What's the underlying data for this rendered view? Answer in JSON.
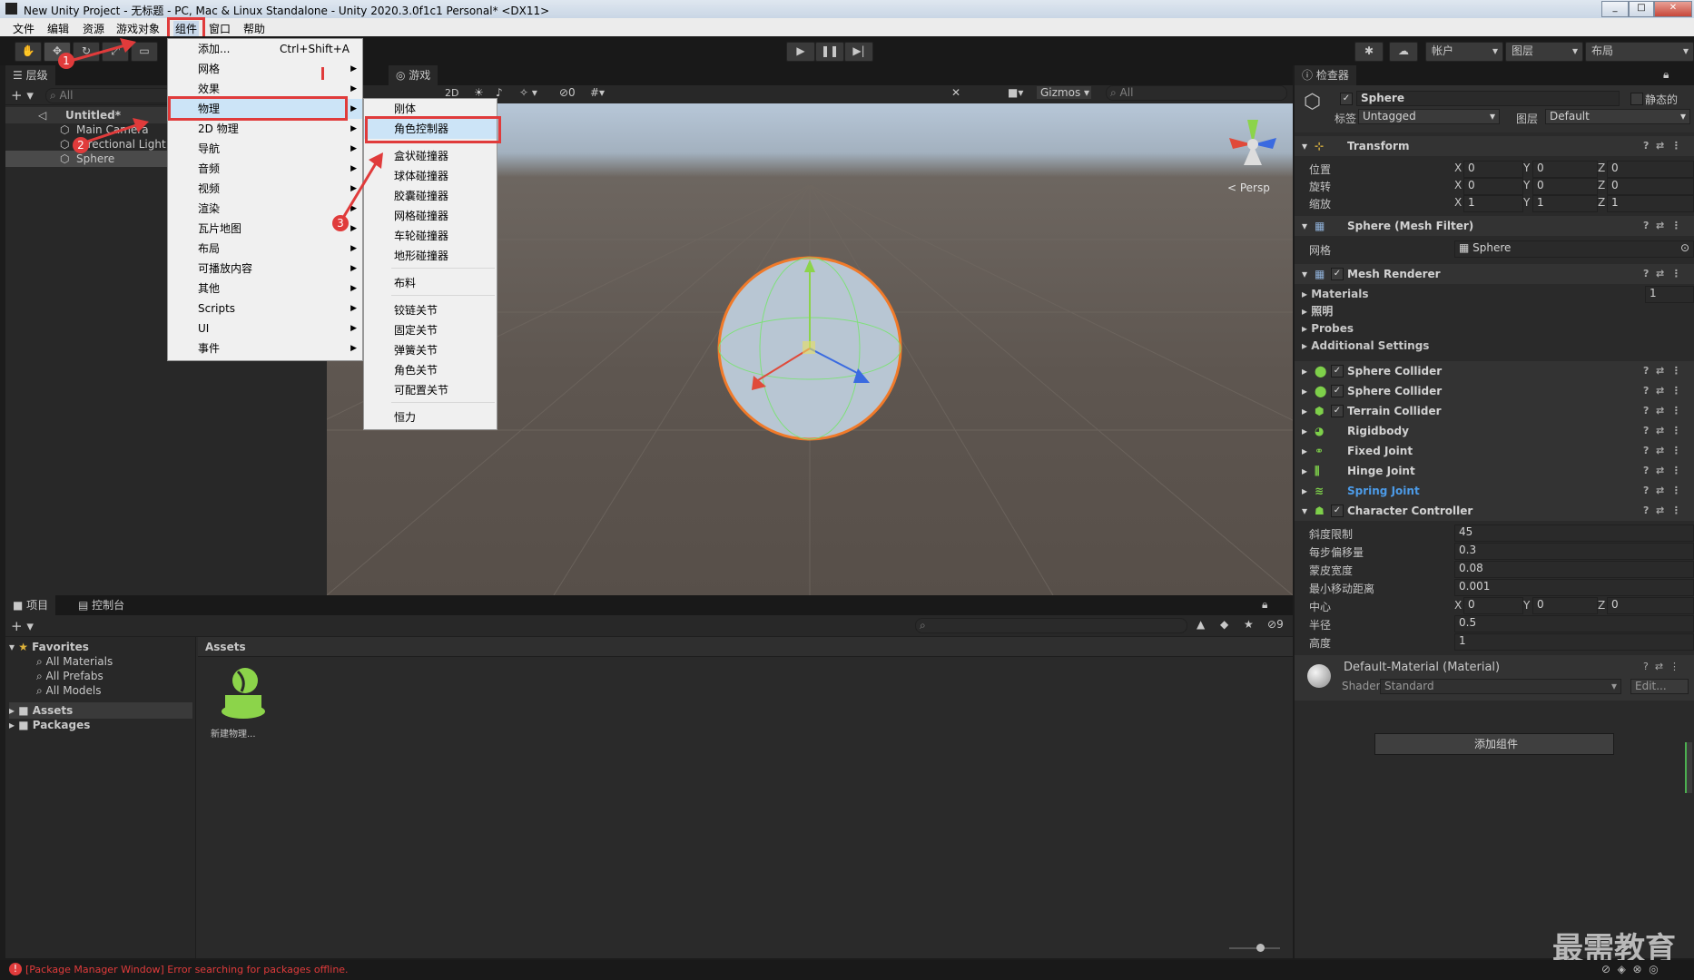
{
  "window": {
    "title": "New Unity Project - 无标题 - PC, Mac & Linux Standalone - Unity 2020.3.0f1c1 Personal* <DX11>"
  },
  "menubar": [
    "文件",
    "编辑",
    "资源",
    "游戏对象",
    "组件",
    "窗口",
    "帮助"
  ],
  "toolbar": {
    "account": "帐户",
    "layers": "图层",
    "layout": "布局"
  },
  "hierarchy": {
    "tab": "层级",
    "search": "All",
    "scene": "Untitled*",
    "items": [
      "Main Camera",
      "Directional Light",
      "Sphere"
    ]
  },
  "component_menu": {
    "items": [
      {
        "label": "添加...",
        "shortcut": "Ctrl+Shift+A"
      },
      {
        "label": "网格"
      },
      {
        "label": "效果"
      },
      {
        "label": "物理"
      },
      {
        "label": "2D 物理"
      },
      {
        "label": "导航"
      },
      {
        "label": "音频"
      },
      {
        "label": "视频"
      },
      {
        "label": "渲染"
      },
      {
        "label": "瓦片地图"
      },
      {
        "label": "布局"
      },
      {
        "label": "可播放内容"
      },
      {
        "label": "其他"
      },
      {
        "label": "Scripts"
      },
      {
        "label": "UI"
      },
      {
        "label": "事件"
      }
    ]
  },
  "physics_menu": {
    "items": [
      "刚体",
      "角色控制器",
      "盒状碰撞器",
      "球体碰撞器",
      "胶囊碰撞器",
      "网格碰撞器",
      "车轮碰撞器",
      "地形碰撞器",
      "布料",
      "铰链关节",
      "固定关节",
      "弹簧关节",
      "角色关节",
      "可配置关节",
      "恒力"
    ]
  },
  "game": {
    "tab": "游戏",
    "gizmos": "Gizmos",
    "search": "All",
    "persp": "< Persp",
    "mode_2d": "2D"
  },
  "inspector": {
    "tab": "检查器",
    "name": "Sphere",
    "static": "静态的",
    "tag_label": "标签",
    "tag": "Untagged",
    "layer_label": "图层",
    "layer": "Default",
    "transform": {
      "title": "Transform",
      "position_label": "位置",
      "rotation_label": "旋转",
      "scale_label": "缩放",
      "position": [
        "0",
        "0",
        "0"
      ],
      "rotation": [
        "0",
        "0",
        "0"
      ],
      "scale": [
        "1",
        "1",
        "1"
      ]
    },
    "mesh_filter": {
      "title": "Sphere (Mesh Filter)",
      "mesh_label": "网格",
      "mesh": "Sphere"
    },
    "mesh_renderer": {
      "title": "Mesh Renderer",
      "materials": "Materials",
      "materials_count": "1",
      "lighting": "照明",
      "probes": "Probes",
      "additional": "Additional Settings"
    },
    "components": [
      "Sphere Collider",
      "Sphere Collider",
      "Terrain Collider",
      "Rigidbody",
      "Fixed Joint",
      "Hinge Joint",
      "Spring Joint"
    ],
    "character_controller": {
      "title": "Character Controller",
      "slope_label": "斜度限制",
      "slope": "45",
      "step_label": "每步偏移量",
      "step": "0.3",
      "skin_label": "蒙皮宽度",
      "skin": "0.08",
      "min_move_label": "最小移动距离",
      "min_move": "0.001",
      "center_label": "中心",
      "center": [
        "0",
        "0",
        "0"
      ],
      "radius_label": "半径",
      "radius": "0.5",
      "height_label": "高度",
      "height": "1"
    },
    "material": {
      "name": "Default-Material (Material)",
      "shader_label": "Shader",
      "shader": "Standard",
      "edit": "Edit..."
    },
    "add_component": "添加组件"
  },
  "project": {
    "tab_project": "项目",
    "tab_console": "控制台",
    "favorites": "Favorites",
    "fav_items": [
      "All Materials",
      "All Prefabs",
      "All Models"
    ],
    "assets": "Assets",
    "packages": "Packages",
    "assets_header": "Assets",
    "asset_item": "新建物理...",
    "hidden_count": "9"
  },
  "status": {
    "error": "[Package Manager Window] Error searching for packages offline."
  },
  "annotations": [
    "1",
    "2",
    "3"
  ],
  "watermark": "最需教育",
  "colors": {
    "selection": "#2c5d87",
    "annotation": "#e03b3b",
    "link": "#4c9be8"
  }
}
